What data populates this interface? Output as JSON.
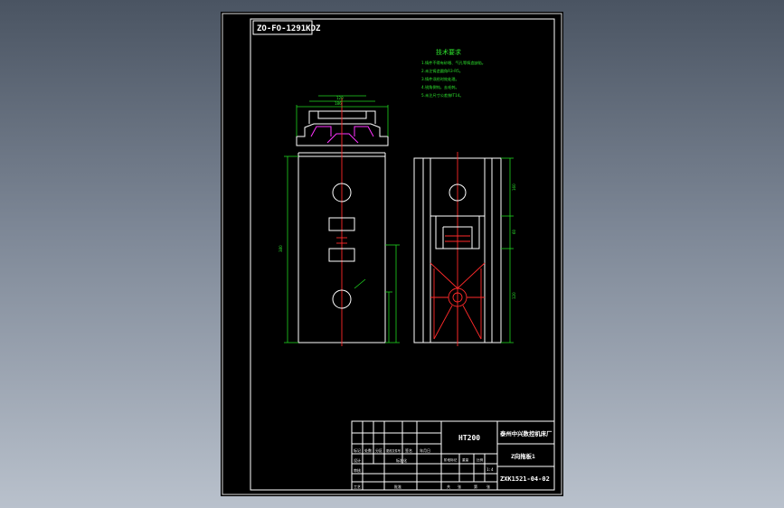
{
  "drawing": {
    "drawing_code": "ZO-FO-1291KDZ",
    "tech_requirements_title": "技术要求",
    "tech_requirements": [
      "1.铸件不得有砂眼、气孔等铸造缺陷。",
      "2.未注铸造圆角R3-R5。",
      "3.铸件须经时效处理。",
      "4.锐角倒钝，去毛刺。",
      "5.未注尺寸公差按IT14。"
    ],
    "dimensions": {
      "top_overall": "186",
      "top_inner": "120",
      "height_left": "380",
      "right_top": "160",
      "right_bottom": "120",
      "right_mid": "60"
    }
  },
  "title_block": {
    "material": "HT200",
    "company": "泰州中兴数控机床厂",
    "part_name": "Z向拖板1",
    "drawing_number": "ZXK1521-04-02",
    "scale": "1:4",
    "header_labels": [
      "标记",
      "处数",
      "分区",
      "更改文件号",
      "签名",
      "年月日"
    ],
    "row_labels": [
      "设计",
      "审核",
      "工艺"
    ],
    "std_label": "标准化",
    "approve_label": "批准",
    "stage_labels": [
      "阶段标记",
      "重量",
      "比例"
    ],
    "sheet_labels": [
      "共",
      "张",
      "第",
      "张"
    ]
  }
}
